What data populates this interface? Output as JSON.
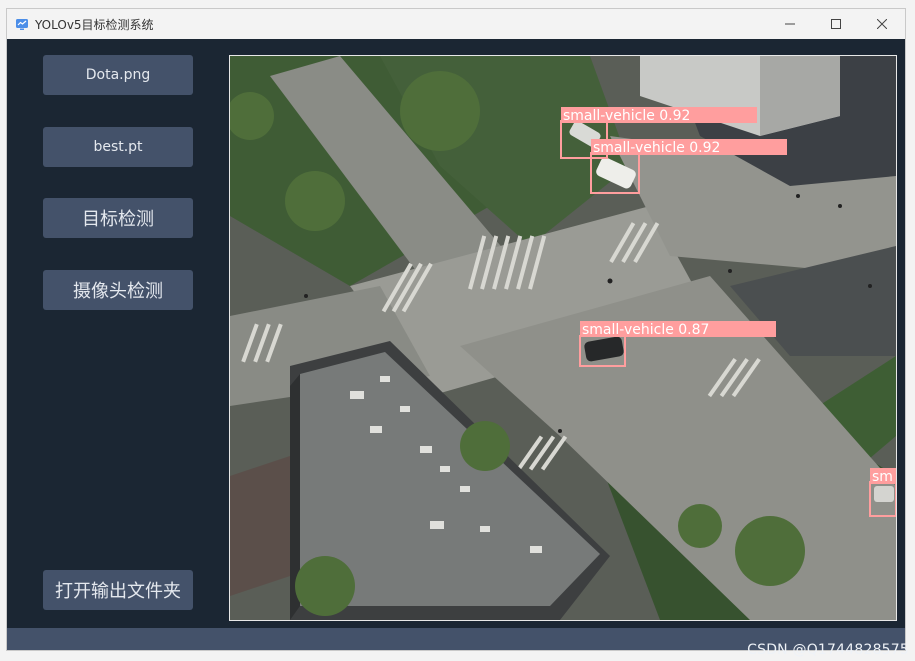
{
  "window": {
    "title": "YOLOv5目标检测系统"
  },
  "sidebar": {
    "image_button": "Dota.png",
    "weights_button": "best.pt",
    "detect_button": "目标检测",
    "camera_button": "摄像头检测",
    "open_folder_button": "打开输出文件夹"
  },
  "detections": [
    {
      "label": "small-vehicle 0.92"
    },
    {
      "label": "small-vehicle 0.92"
    },
    {
      "label": "small-vehicle 0.87"
    },
    {
      "label": "sm"
    }
  ],
  "statusbar": {
    "watermark": "CSDN @Q1744828575"
  },
  "colors": {
    "box": "#ff9e9e",
    "accent": "#44526a",
    "background": "#1b2633"
  }
}
